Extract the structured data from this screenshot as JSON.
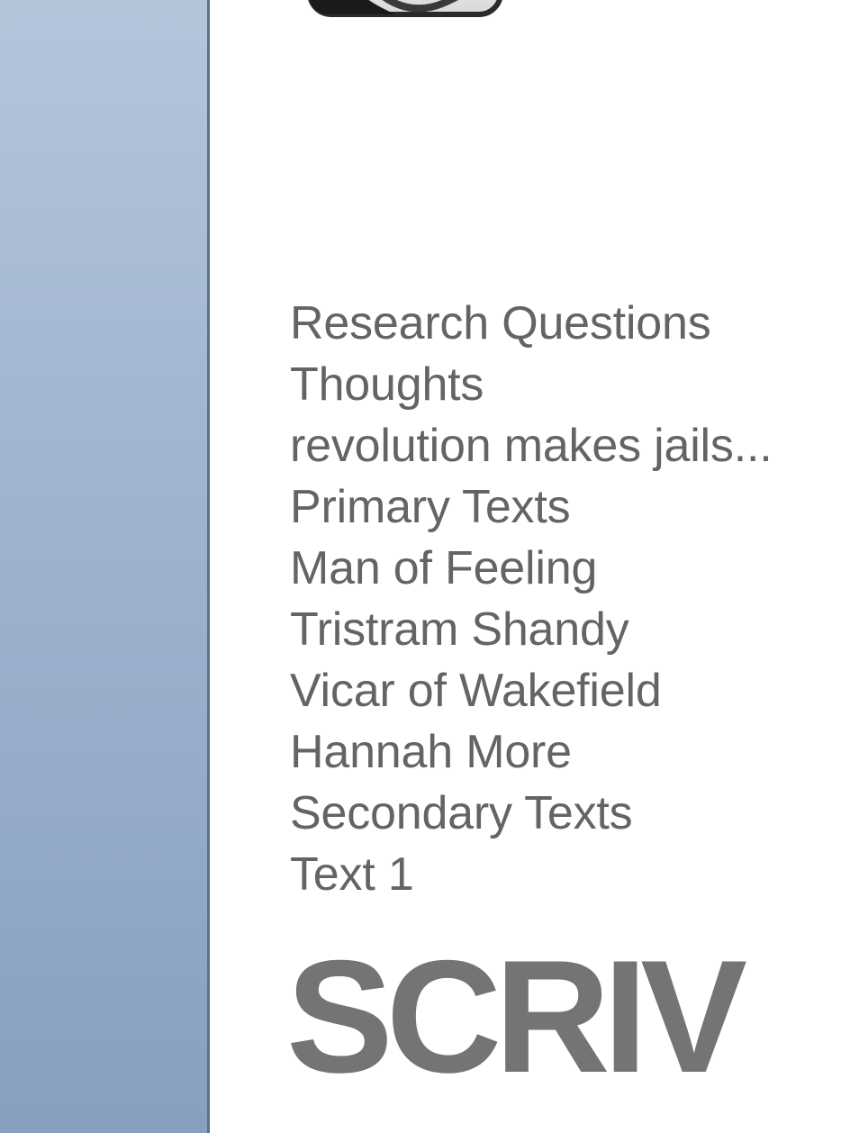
{
  "sidebar": {
    "color_top": "#b4c5da",
    "color_bottom": "#87a0c0"
  },
  "app_icon": {
    "icon": "scrivener-app-icon"
  },
  "binder": {
    "items": [
      {
        "label": "Research Questions"
      },
      {
        "label": "Thoughts"
      },
      {
        "label": "revolution makes jails..."
      },
      {
        "label": "Primary Texts"
      },
      {
        "label": "Man of Feeling"
      },
      {
        "label": "Tristram Shandy"
      },
      {
        "label": "Vicar of Wakefield"
      },
      {
        "label": "Hannah More"
      },
      {
        "label": "Secondary Texts"
      },
      {
        "label": "Text 1"
      }
    ]
  },
  "brand": {
    "text": "SCRIV",
    "color": "#747474"
  }
}
